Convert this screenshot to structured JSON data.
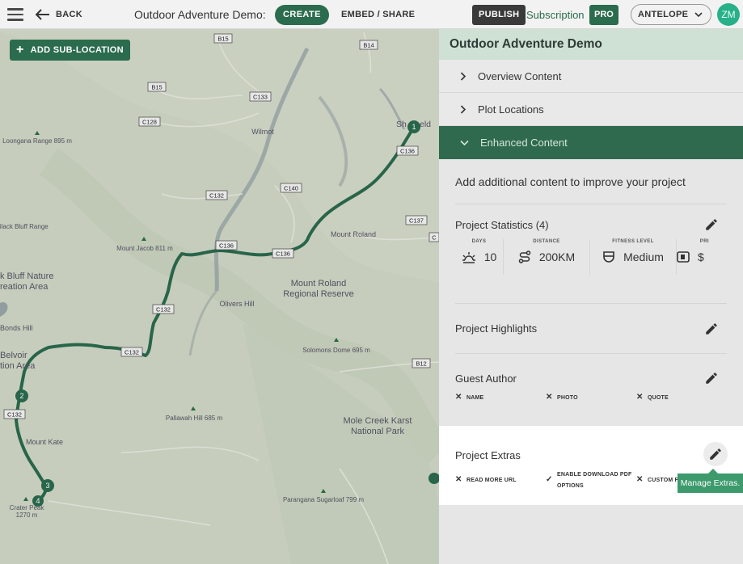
{
  "topbar": {
    "back_label": "BACK",
    "project_title": "Outdoor Adventure Demo:",
    "create_label": "CREATE",
    "embed_label": "EMBED / SHARE",
    "publish_label": "PUBLISH",
    "subscription_label": "Subscription",
    "pro_label": "PRO",
    "account_label": "ANTELOPE",
    "avatar_initials": "ZM"
  },
  "map": {
    "add_sublocation_label": "ADD SUB-LOCATION",
    "road_labels": [
      "B15",
      "B14",
      "B15",
      "C133",
      "C128",
      "C136",
      "C140",
      "C132",
      "C137",
      "C136",
      "C136",
      "C132",
      "C132",
      "B12",
      "C132"
    ],
    "place_labels": [
      "Loongana Range 895 m",
      "Wilmot",
      "Sh",
      "eld",
      "Black Bluff Range",
      "Mount Jacob 811 m",
      "Mount Roland",
      "k Bluff Nature",
      "reation Area",
      "Mount Roland",
      "Regional Reserve",
      "Olivers Hill",
      "Bonds Hill",
      "Belvoir",
      "tion Area",
      "Solomons Dome 695 m",
      "Pallawah Hill 685 m",
      "Mole Creek Karst",
      "National Park",
      "Mount Kate",
      "Crater Peak",
      "1270 m",
      "Parangana Sugarloaf 799 m"
    ],
    "markers": [
      "1",
      "2",
      "3",
      "4"
    ],
    "route_color": "#2b6b4e"
  },
  "panel": {
    "title": "Outdoor Adventure Demo",
    "sections": [
      {
        "label": "Overview Content"
      },
      {
        "label": "Plot Locations"
      },
      {
        "label": "Enhanced Content"
      }
    ],
    "intro": "Add additional content to improve your project",
    "statistics": {
      "title": "Project Statistics (4)",
      "items": [
        {
          "label": "DAYS",
          "value": "10",
          "icon": "sun-icon"
        },
        {
          "label": "DISTANCE",
          "value": "200KM",
          "icon": "route-icon"
        },
        {
          "label": "FITNESS LEVEL",
          "value": "Medium",
          "icon": "shield-icon"
        },
        {
          "label": "PRI",
          "value": "$",
          "icon": "price-icon"
        }
      ]
    },
    "highlights": {
      "title": "Project Highlights"
    },
    "guest_author": {
      "title": "Guest Author",
      "options": [
        {
          "label": "NAME",
          "state": "off"
        },
        {
          "label": "PHOTO",
          "state": "off"
        },
        {
          "label": "QUOTE",
          "state": "off"
        }
      ]
    },
    "extras": {
      "title": "Project Extras",
      "options": [
        {
          "label": "READ MORE URL",
          "state": "off"
        },
        {
          "label": "ENABLE DOWNLOAD PDF OPTIONS",
          "state": "on"
        },
        {
          "label": "CUSTOM F",
          "state": "off"
        }
      ],
      "tooltip": "Manage Extras."
    }
  },
  "colors": {
    "accent": "#2b6b4e",
    "accent_light": "#cfe0d5",
    "tooltip": "#3c9a6c",
    "avatar": "#27b08a"
  }
}
